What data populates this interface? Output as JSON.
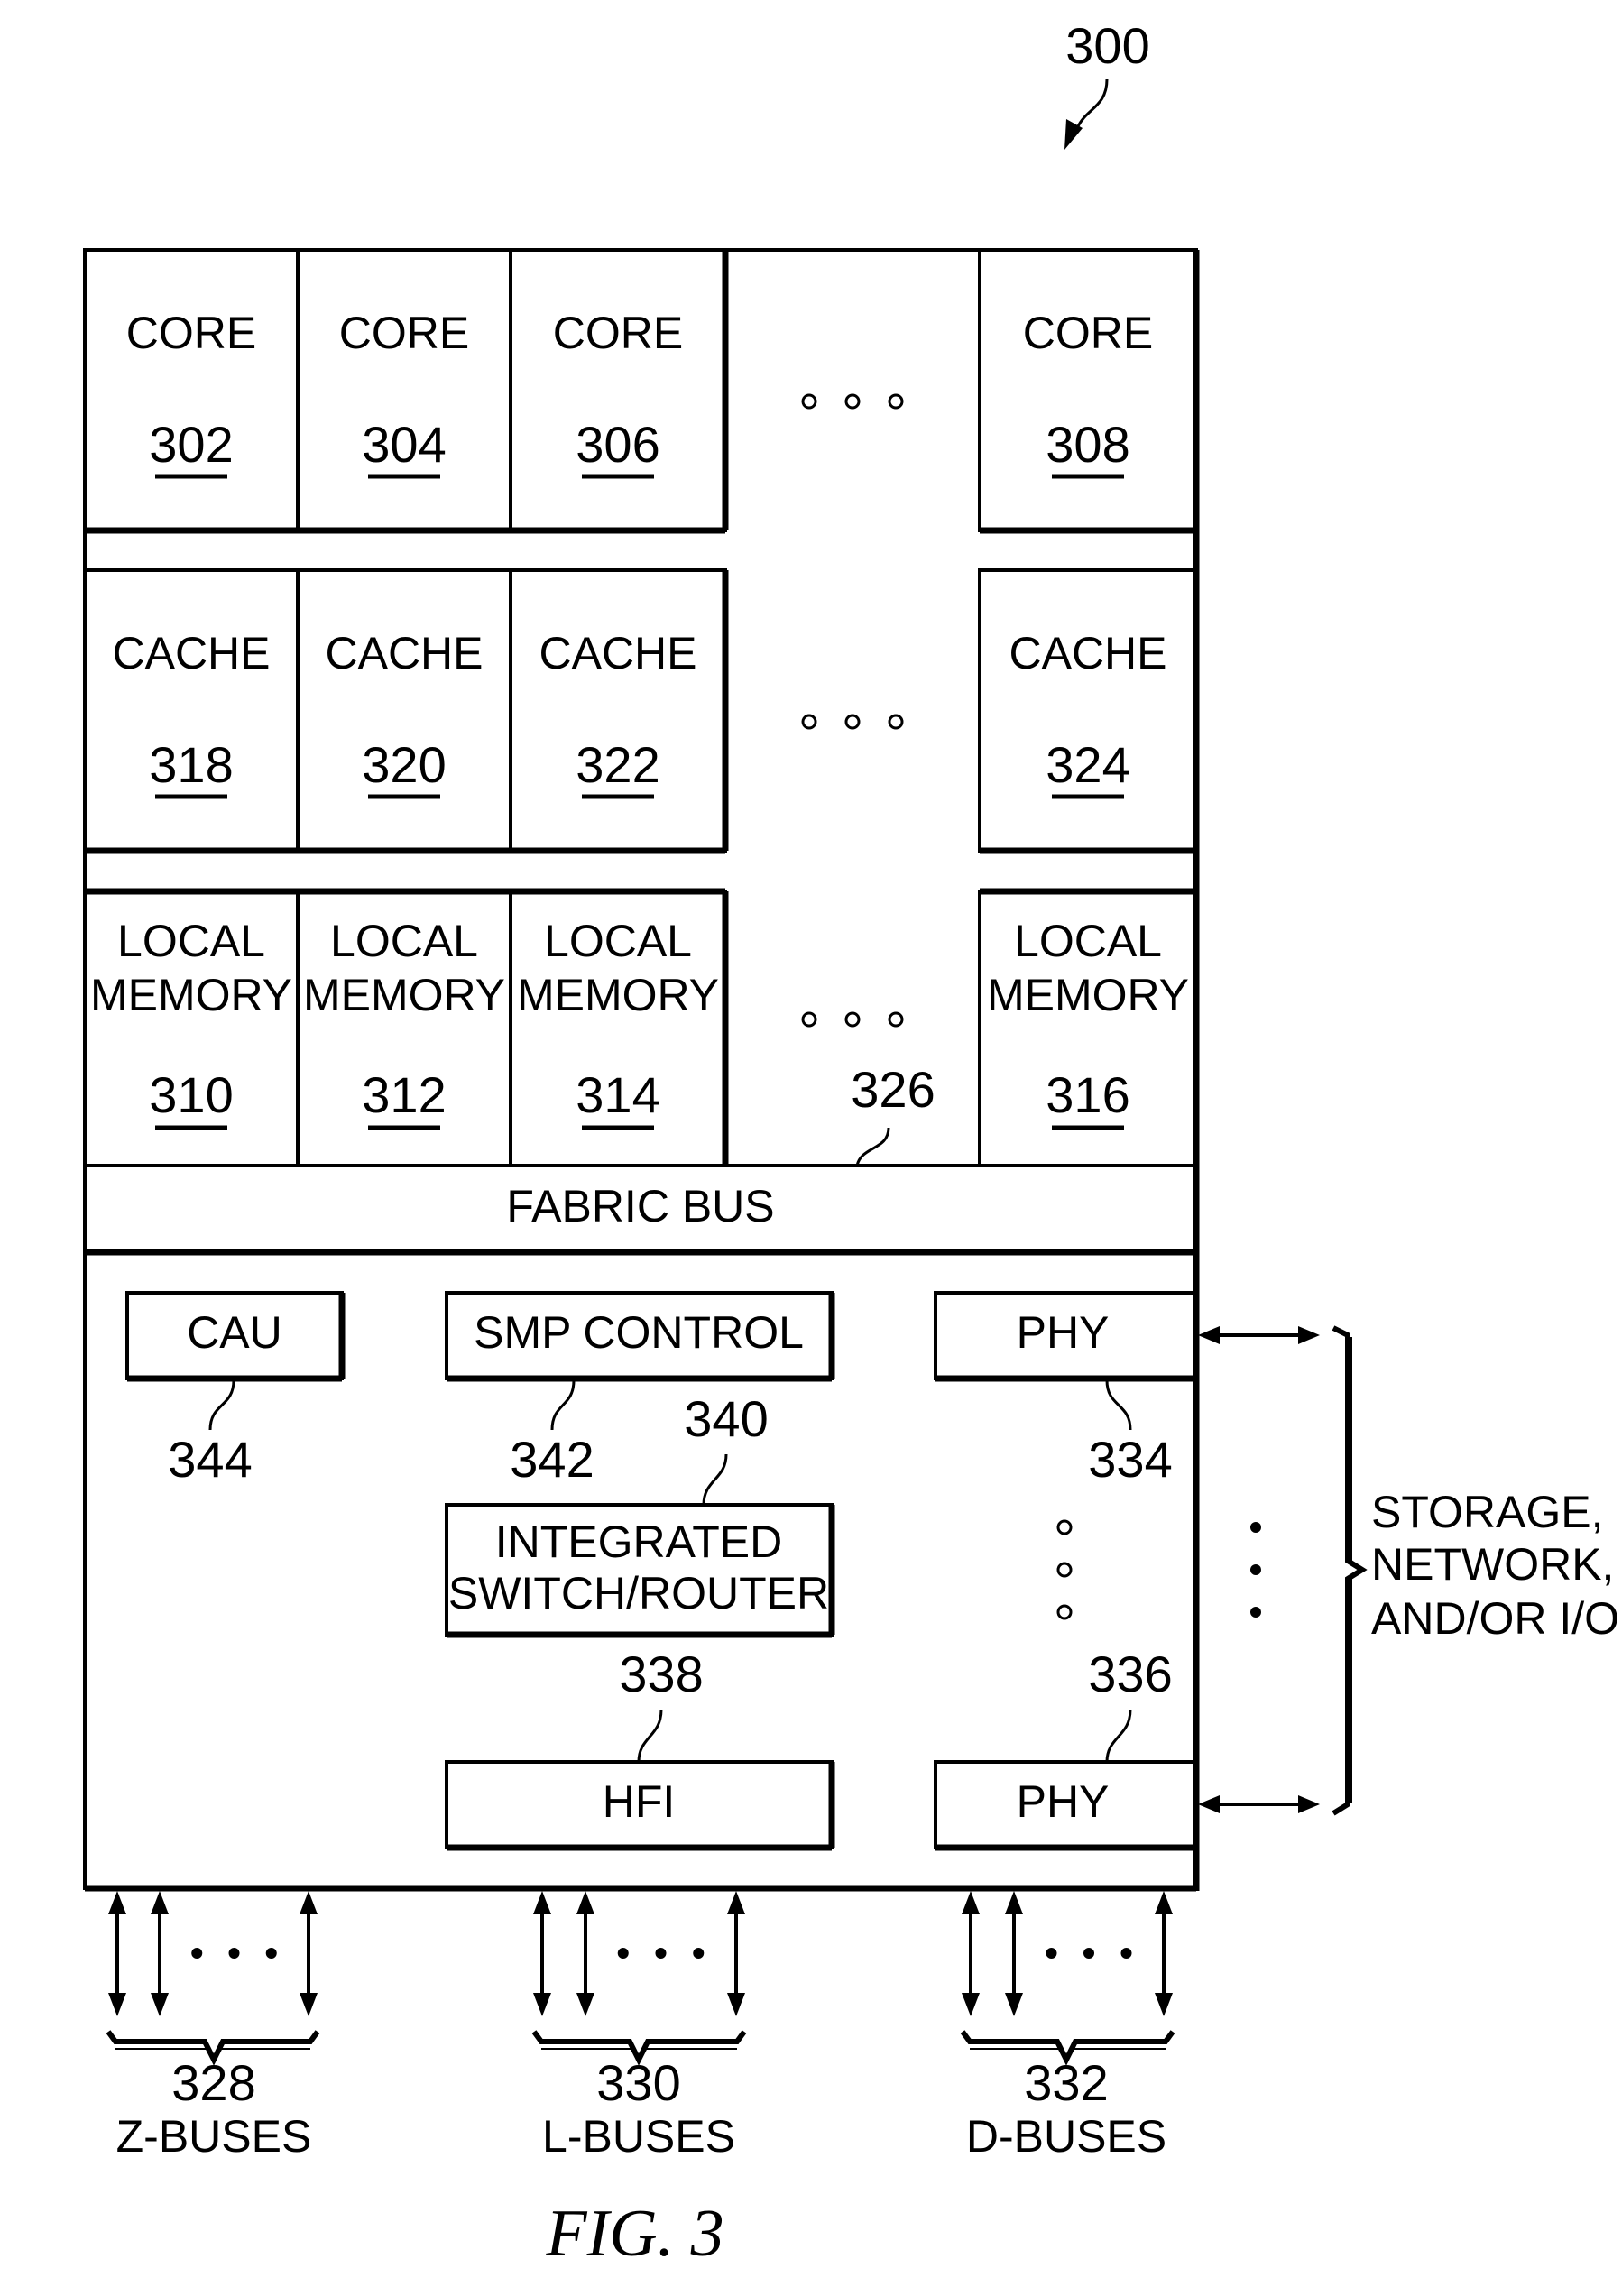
{
  "figure": {
    "reference": "300",
    "caption": "FIG. 3"
  },
  "rows": {
    "cores": {
      "label": "CORE",
      "items": [
        "302",
        "304",
        "306",
        "308"
      ]
    },
    "caches": {
      "label": "CACHE",
      "items": [
        "318",
        "320",
        "322",
        "324"
      ]
    },
    "memories": {
      "label_line1": "LOCAL",
      "label_line2": "MEMORY",
      "items": [
        "310",
        "312",
        "314",
        "316"
      ]
    }
  },
  "fabric_bus": {
    "label": "FABRIC BUS",
    "ref": "326"
  },
  "components": {
    "cau": {
      "label": "CAU",
      "ref": "344"
    },
    "smp_control": {
      "label": "SMP CONTROL",
      "ref": "342"
    },
    "switch_router": {
      "label_line1": "INTEGRATED",
      "label_line2": "SWITCH/ROUTER",
      "ref": "340"
    },
    "hfi": {
      "label": "HFI",
      "ref": "338"
    },
    "phy_top": {
      "label": "PHY",
      "ref": "334"
    },
    "phy_bottom": {
      "label": "PHY",
      "ref": "336"
    }
  },
  "external": {
    "line1": "STORAGE,",
    "line2": "NETWORK,",
    "line3": "AND/OR I/O"
  },
  "buses": [
    {
      "ref": "328",
      "label": "Z-BUSES"
    },
    {
      "ref": "330",
      "label": "L-BUSES"
    },
    {
      "ref": "332",
      "label": "D-BUSES"
    }
  ]
}
